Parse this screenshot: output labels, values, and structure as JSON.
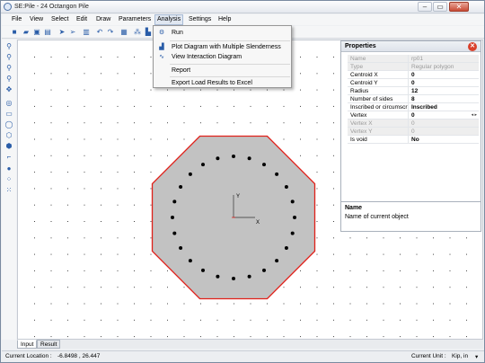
{
  "window": {
    "title": "SE:Pile - 24 Octangon Pile"
  },
  "window_controls": {
    "minimize": "–",
    "maximize": "▭",
    "close": "✕"
  },
  "menubar": {
    "items": [
      "File",
      "View",
      "Select",
      "Edit",
      "Draw",
      "Parameters",
      "Analysis",
      "Settings",
      "Help"
    ],
    "active": "Analysis"
  },
  "analysis_menu": {
    "items": [
      {
        "label": "Run",
        "icon": "run-icon"
      },
      {
        "label": "Plot Diagram with Multiple Slenderness",
        "icon": "chart-icon"
      },
      {
        "label": "View Interaction Diagram",
        "icon": "curve-icon"
      },
      {
        "label": "Report",
        "icon": ""
      },
      {
        "label": "Export Load Results to Excel",
        "icon": ""
      }
    ]
  },
  "properties": {
    "title": "Properties",
    "rows": [
      {
        "key": "Name",
        "value": "rp01",
        "disabled": true
      },
      {
        "key": "Type",
        "value": "Regular polygon",
        "disabled": true
      },
      {
        "key": "Centroid  X",
        "value": "0",
        "disabled": false
      },
      {
        "key": "Centroid  Y",
        "value": "0",
        "disabled": false
      },
      {
        "key": "Radius",
        "value": "12",
        "disabled": false
      },
      {
        "key": "Number of sides",
        "value": "8",
        "disabled": false
      },
      {
        "key": "Inscribed or circumscribed",
        "value": "Inscribed",
        "disabled": false
      },
      {
        "key": "Vertex",
        "value": "0",
        "disabled": false
      },
      {
        "key": "Vertex X",
        "value": "0",
        "disabled": true
      },
      {
        "key": "Vertex Y",
        "value": "0",
        "disabled": true
      },
      {
        "key": "Is void",
        "value": "No",
        "disabled": false
      }
    ]
  },
  "description": {
    "title": "Name",
    "text": "Name of current object"
  },
  "canvas": {
    "axis_x_label": "X",
    "axis_y_label": "Y",
    "polygon_fill": "#c2c2c2",
    "polygon_stroke": "#e0201a",
    "pile_count": 24,
    "polygon_sides": 8
  },
  "tabs": {
    "items": [
      "Input",
      "Result"
    ],
    "active": "Input"
  },
  "status": {
    "location_label": "Current Location :",
    "location_value": "-6.8498 , 26.447",
    "unit_label": "Current Unit :",
    "unit_value": "Kip, in"
  }
}
